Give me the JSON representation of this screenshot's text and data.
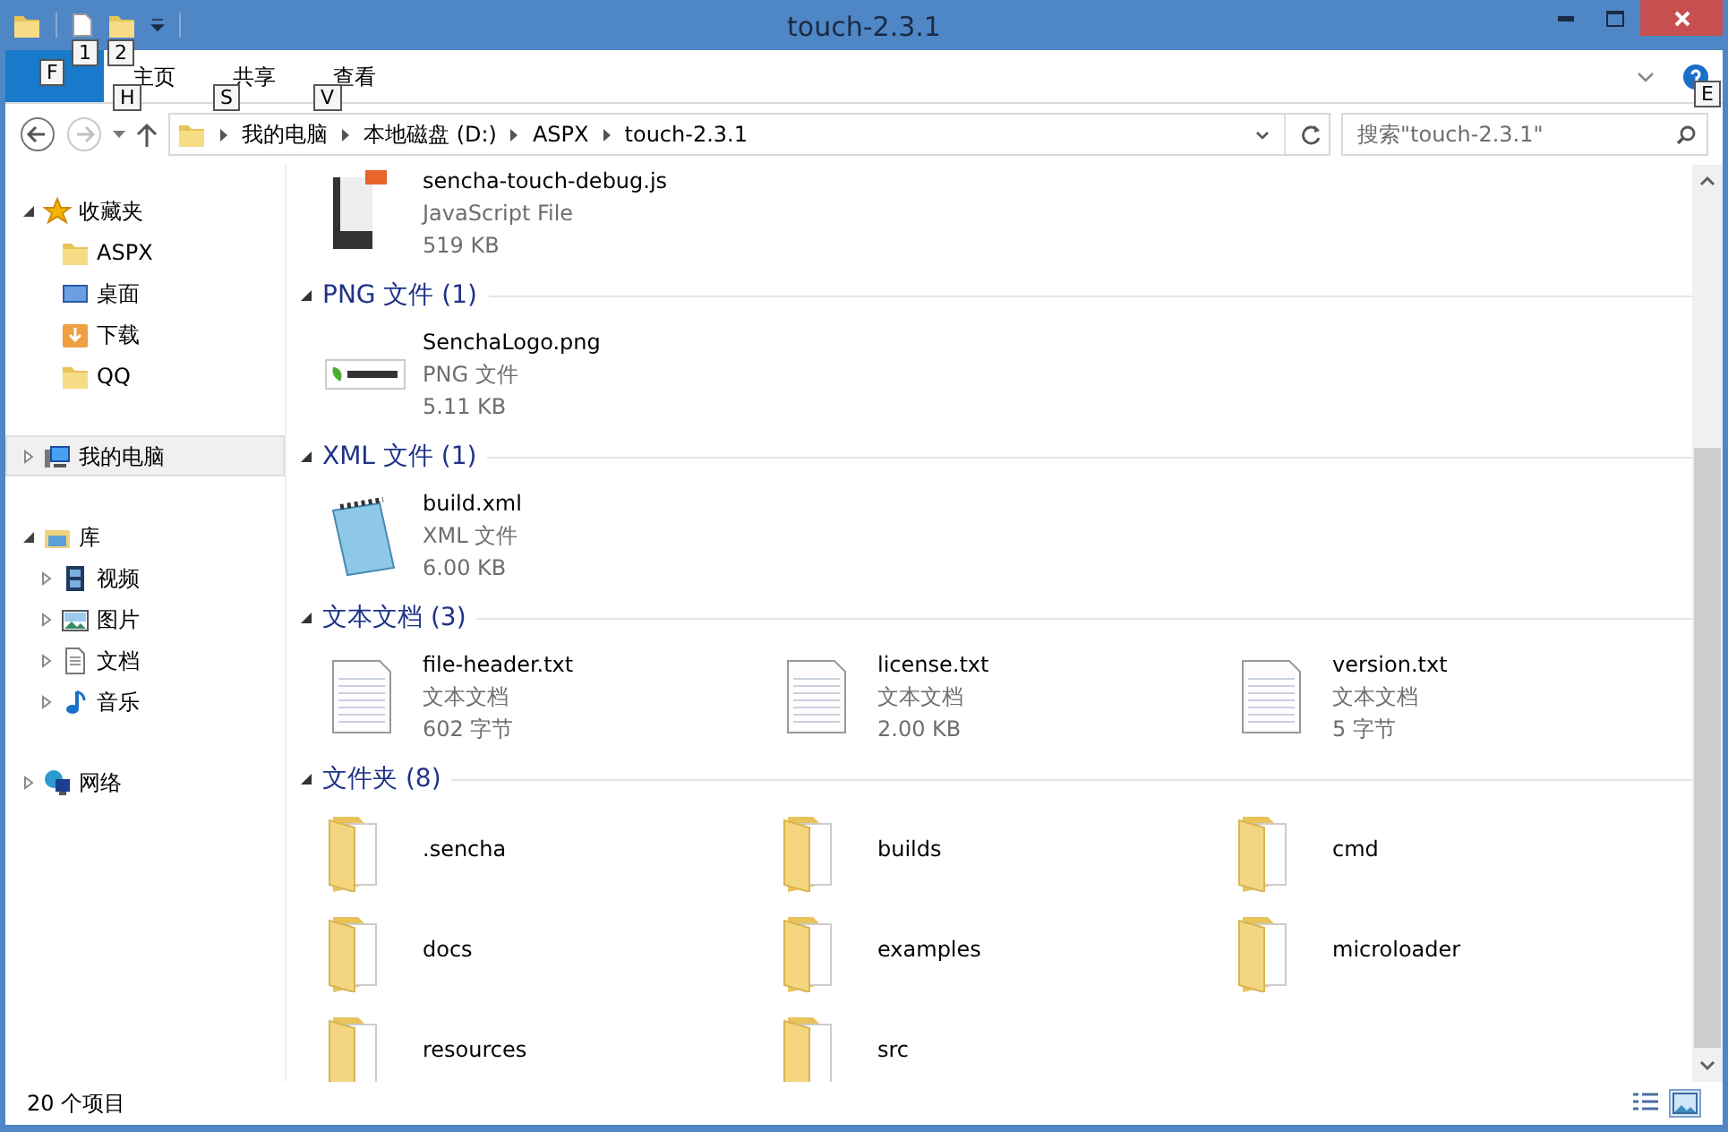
{
  "window": {
    "title": "touch-2.3.1"
  },
  "quick_access": {
    "keytips": [
      "1",
      "2"
    ]
  },
  "ribbon": {
    "file_keytip": "F",
    "tabs": [
      {
        "label": "主页",
        "keytip": "H",
        "selected": false
      },
      {
        "label": "共享",
        "keytip": "S",
        "selected": false
      },
      {
        "label": "查看",
        "keytip": "V",
        "selected": false
      }
    ],
    "help_keytip": "E"
  },
  "address": {
    "breadcrumbs": [
      "我的电脑",
      "本地磁盘 (D:)",
      "ASPX",
      "touch-2.3.1"
    ],
    "search_placeholder": "搜索\"touch-2.3.1\""
  },
  "sidebar": {
    "sections": [
      {
        "label": "收藏夹",
        "kind": "star",
        "expanded": true,
        "selected": false,
        "children": [
          {
            "label": "ASPX",
            "kind": "folder"
          },
          {
            "label": "桌面",
            "kind": "desktop"
          },
          {
            "label": "下载",
            "kind": "download"
          },
          {
            "label": "QQ",
            "kind": "folder"
          }
        ]
      },
      {
        "label": "我的电脑",
        "kind": "computer",
        "expanded": false,
        "selected": true
      },
      {
        "label": "库",
        "kind": "library",
        "expanded": true,
        "selected": false,
        "children": [
          {
            "label": "视频",
            "kind": "video",
            "expanded": false
          },
          {
            "label": "图片",
            "kind": "picture",
            "expanded": false
          },
          {
            "label": "文档",
            "kind": "document",
            "expanded": false
          },
          {
            "label": "音乐",
            "kind": "music",
            "expanded": false
          }
        ]
      },
      {
        "label": "网络",
        "kind": "network",
        "expanded": false,
        "selected": false
      }
    ]
  },
  "groups": [
    {
      "items": [
        {
          "name": "sencha-touch-debug.js",
          "type": "JavaScript File",
          "size": "519 KB",
          "kind": "js"
        }
      ]
    },
    {
      "title": "PNG 文件 (1)",
      "expanded": true,
      "items": [
        {
          "name": "SenchaLogo.png",
          "type": "PNG 文件",
          "size": "5.11 KB",
          "kind": "png"
        }
      ]
    },
    {
      "title": "XML 文件 (1)",
      "expanded": true,
      "items": [
        {
          "name": "build.xml",
          "type": "XML 文件",
          "size": "6.00 KB",
          "kind": "xml"
        }
      ]
    },
    {
      "title": "文本文档 (3)",
      "expanded": true,
      "items": [
        {
          "name": "file-header.txt",
          "type": "文本文档",
          "size": "602 字节",
          "kind": "txt"
        },
        {
          "name": "license.txt",
          "type": "文本文档",
          "size": "2.00 KB",
          "kind": "txt"
        },
        {
          "name": "version.txt",
          "type": "文本文档",
          "size": "5 字节",
          "kind": "txt"
        }
      ]
    },
    {
      "title": "文件夹 (8)",
      "expanded": true,
      "items": [
        {
          "name": ".sencha",
          "kind": "folder"
        },
        {
          "name": "builds",
          "kind": "folder"
        },
        {
          "name": "cmd",
          "kind": "folder"
        },
        {
          "name": "docs",
          "kind": "folder"
        },
        {
          "name": "examples",
          "kind": "folder"
        },
        {
          "name": "microloader",
          "kind": "folder"
        },
        {
          "name": "resources",
          "kind": "folder"
        },
        {
          "name": "src",
          "kind": "folder"
        }
      ]
    }
  ],
  "status_bar": {
    "count": "20 个项目",
    "views": [
      {
        "kind": "details",
        "selected": false
      },
      {
        "kind": "large-icons",
        "selected": true
      }
    ]
  }
}
